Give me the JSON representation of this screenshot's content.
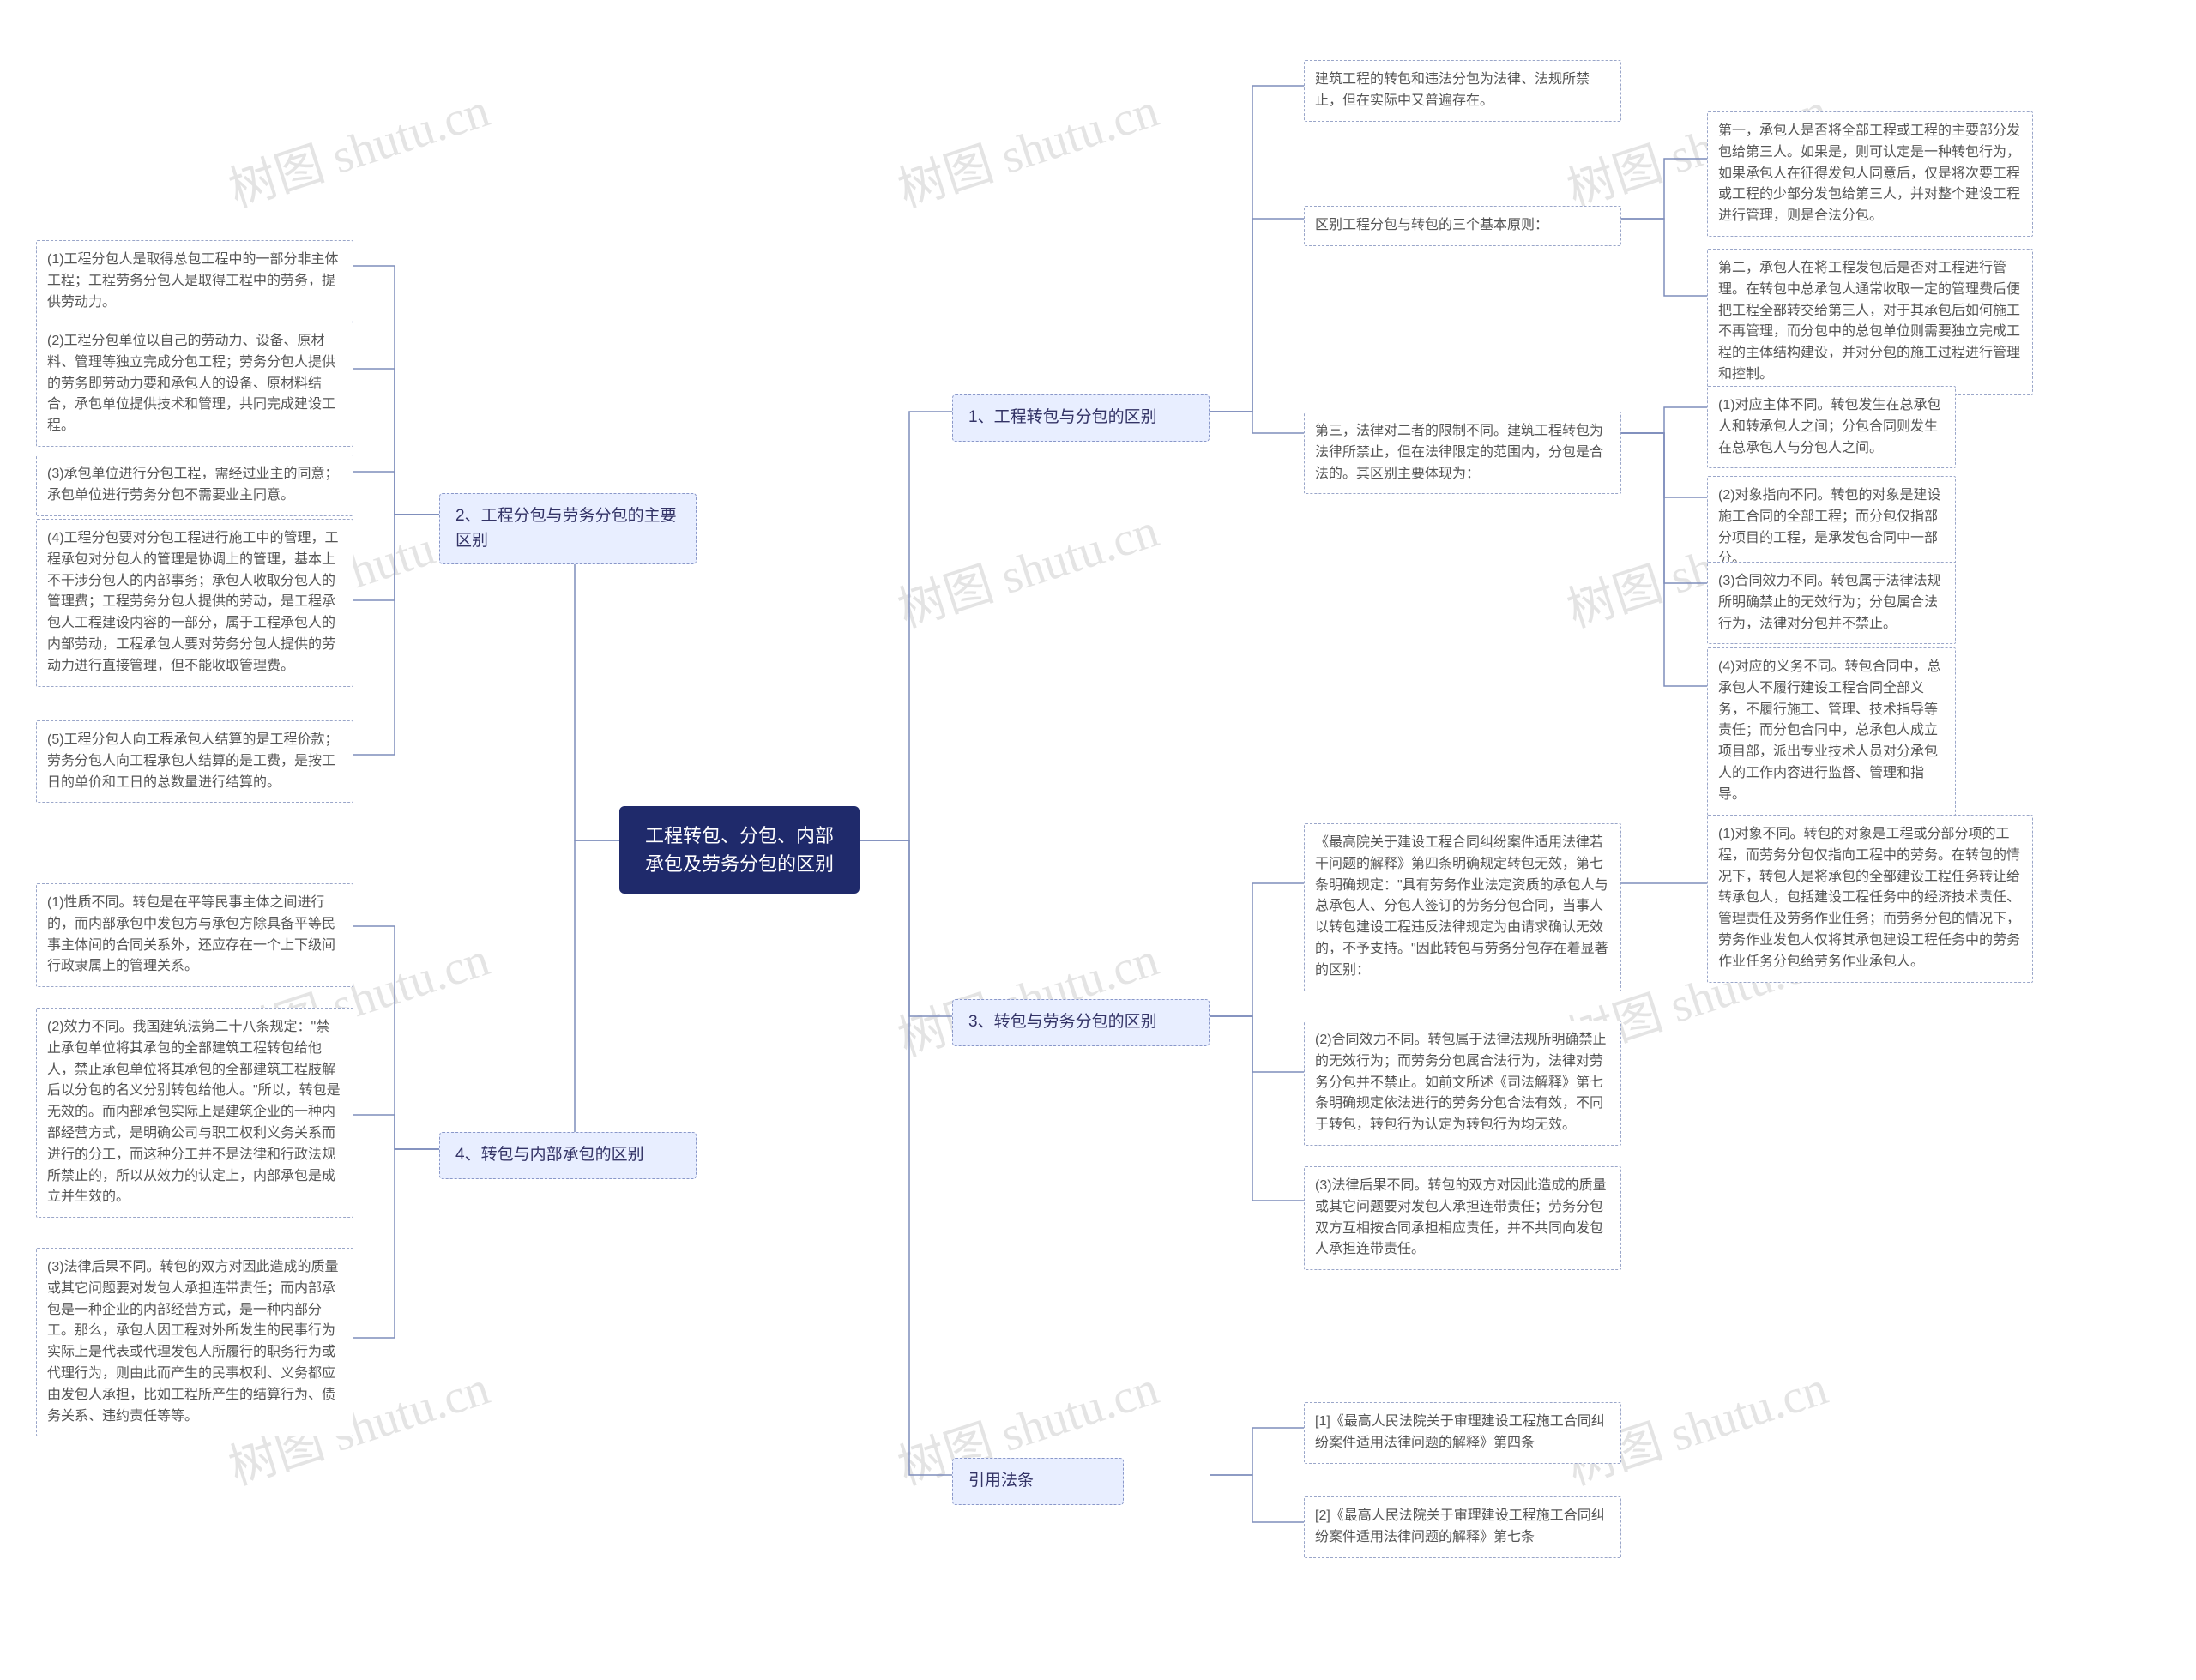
{
  "root": "工程转包、分包、内部承包及劳务分包的区别",
  "branch1": {
    "title": "1、工程转包与分包的区别",
    "n1": "建筑工程的转包和违法分包为法律、法规所禁止，但在实际中又普遍存在。",
    "n2": "区别工程分包与转包的三个基本原则：",
    "n2a": "第一，承包人是否将全部工程或工程的主要部分发包给第三人。如果是，则可认定是一种转包行为，如果承包人在征得发包人同意后，仅是将次要工程或工程的少部分发包给第三人，并对整个建设工程进行管理，则是合法分包。",
    "n2b": "第二，承包人在将工程发包后是否对工程进行管理。在转包中总承包人通常收取一定的管理费后便把工程全部转交给第三人，对于其承包后如何施工不再管理，而分包中的总包单位则需要独立完成工程的主体结构建设，并对分包的施工过程进行管理和控制。",
    "n2c": "第三，法律对二者的限制不同。建筑工程转包为法律所禁止，但在法律限定的范围内，分包是合法的。其区别主要体现为：",
    "n2c1": "(1)对应主体不同。转包发生在总承包人和转承包人之间；分包合同则发生在总承包人与分包人之间。",
    "n2c2": "(2)对象指向不同。转包的对象是建设施工合同的全部工程；而分包仅指部分项目的工程，是承发包合同中一部分。",
    "n2c3": "(3)合同效力不同。转包属于法律法规所明确禁止的无效行为；分包属合法行为，法律对分包并不禁止。",
    "n2c4": "(4)对应的义务不同。转包合同中，总承包人不履行建设工程合同全部义务，不履行施工、管理、技术指导等责任；而分包合同中，总承包人成立项目部，派出专业技术人员对分承包人的工作内容进行监督、管理和指导。"
  },
  "branch2": {
    "title": "2、工程分包与劳务分包的主要区别",
    "n1": "(1)工程分包人是取得总包工程中的一部分非主体工程；工程劳务分包人是取得工程中的劳务，提供劳动力。",
    "n2": "(2)工程分包单位以自己的劳动力、设备、原材料、管理等独立完成分包工程；劳务分包人提供的劳务即劳动力要和承包人的设备、原材料结合，承包单位提供技术和管理，共同完成建设工程。",
    "n3": "(3)承包单位进行分包工程，需经过业主的同意；承包单位进行劳务分包不需要业主同意。",
    "n4": "(4)工程分包要对分包工程进行施工中的管理，工程承包对分包人的管理是协调上的管理，基本上不干涉分包人的内部事务；承包人收取分包人的管理费；工程劳务分包人提供的劳动，是工程承包人工程建设内容的一部分，属于工程承包人的内部劳动，工程承包人要对劳务分包人提供的劳动力进行直接管理，但不能收取管理费。",
    "n5": "(5)工程分包人向工程承包人结算的是工程价款；劳务分包人向工程承包人结算的是工费，是按工日的单价和工日的总数量进行结算的。"
  },
  "branch3": {
    "title": "3、转包与劳务分包的区别",
    "n1": "《最高院关于建设工程合同纠纷案件适用法律若干问题的解释》第四条明确规定转包无效，第七条明确规定：\"具有劳务作业法定资质的承包人与总承包人、分包人签订的劳务分包合同，当事人以转包建设工程违反法律规定为由请求确认无效的，不予支持。\"因此转包与劳务分包存在着显著的区别：",
    "n1a": "(1)对象不同。转包的对象是工程或分部分项的工程，而劳务分包仅指向工程中的劳务。在转包的情况下，转包人是将承包的全部建设工程任务转让给转承包人，包括建设工程任务中的经济技术责任、管理责任及劳务作业任务；而劳务分包的情况下，劳务作业发包人仅将其承包建设工程任务中的劳务作业任务分包给劳务作业承包人。",
    "n1b": "(2)合同效力不同。转包属于法律法规所明确禁止的无效行为；而劳务分包属合法行为，法律对劳务分包并不禁止。如前文所述《司法解释》第七条明确规定依法进行的劳务分包合法有效，不同于转包，转包行为认定为转包行为均无效。",
    "n1c": "(3)法律后果不同。转包的双方对因此造成的质量或其它问题要对发包人承担连带责任；劳务分包双方互相按合同承担相应责任，并不共同向发包人承担连带责任。"
  },
  "branch4": {
    "title": "4、转包与内部承包的区别",
    "n1": "(1)性质不同。转包是在平等民事主体之间进行的，而内部承包中发包方与承包方除具备平等民事主体间的合同关系外，还应存在一个上下级间行政隶属上的管理关系。",
    "n2": "(2)效力不同。我国建筑法第二十八条规定：\"禁止承包单位将其承包的全部建筑工程转包给他人，禁止承包单位将其承包的全部建筑工程肢解后以分包的名义分别转包给他人。\"所以，转包是无效的。而内部承包实际上是建筑企业的一种内部经营方式，是明确公司与职工权利义务关系而进行的分工，而这种分工并不是法律和行政法规所禁止的，所以从效力的认定上，内部承包是成立并生效的。",
    "n3": "(3)法律后果不同。转包的双方对因此造成的质量或其它问题要对发包人承担连带责任；而内部承包是一种企业的内部经营方式，是一种内部分工。那么，承包人因工程对外所发生的民事行为实际上是代表或代理发包人所履行的职务行为或代理行为，则由此而产生的民事权利、义务都应由发包人承担，比如工程所产生的结算行为、债务关系、违约责任等等。"
  },
  "branch5": {
    "title": "引用法条",
    "n1": "[1]《最高人民法院关于审理建设工程施工合同纠纷案件适用法律问题的解释》第四条",
    "n2": "[2]《最高人民法院关于审理建设工程施工合同纠纷案件适用法律问题的解释》第七条"
  },
  "watermark": "树图 shutu.cn"
}
